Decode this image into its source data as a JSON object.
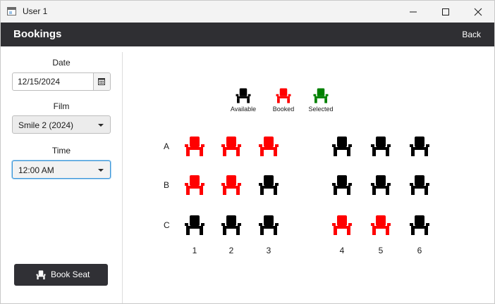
{
  "window": {
    "title": "User 1"
  },
  "header": {
    "title": "Bookings",
    "back_label": "Back"
  },
  "form": {
    "date_label": "Date",
    "date_value": "12/15/2024",
    "film_label": "Film",
    "film_value": "Smile 2 (2024)",
    "time_label": "Time",
    "time_value": "12:00 AM",
    "book_button_label": "Book Seat"
  },
  "legend": [
    {
      "label": "Available",
      "status": "available"
    },
    {
      "label": "Booked",
      "status": "booked"
    },
    {
      "label": "Selected",
      "status": "selected"
    }
  ],
  "colors": {
    "available": "#000000",
    "booked": "#ff0000",
    "selected": "#008000"
  },
  "seating": {
    "rows": [
      "A",
      "B",
      "C"
    ],
    "columns": [
      "1",
      "2",
      "3",
      "4",
      "5",
      "6"
    ],
    "seats": [
      [
        "booked",
        "booked",
        "booked",
        "available",
        "available",
        "available"
      ],
      [
        "booked",
        "booked",
        "available",
        "available",
        "available",
        "available"
      ],
      [
        "available",
        "available",
        "available",
        "booked",
        "booked",
        "available"
      ]
    ]
  }
}
